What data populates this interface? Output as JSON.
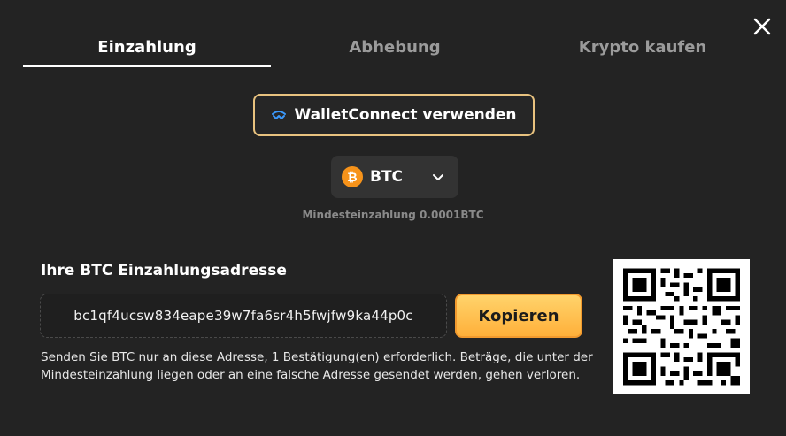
{
  "tabs": [
    {
      "label": "Einzahlung",
      "active": true
    },
    {
      "label": "Abhebung",
      "active": false
    },
    {
      "label": "Krypto kaufen",
      "active": false
    }
  ],
  "walletconnect": {
    "label": "WalletConnect verwenden",
    "icon": "walletconnect-icon"
  },
  "coin": {
    "name": "BTC",
    "icon_letter": "₿",
    "icon_color": "#f7931a"
  },
  "min_deposit": "Mindesteinzahlung 0.0001BTC",
  "address_section": {
    "title": "Ihre BTC Einzahlungsadresse",
    "address": "bc1qf4ucsw834eape39w7fa6sr4h5fwjfw9ka44p0c",
    "copy_label": "Kopieren"
  },
  "notice": "Senden Sie BTC nur an diese Adresse, 1 Bestätigung(en) erforderlich. Beträge, die unter der Mindesteinzahlung liegen oder an eine falsche Adresse gesendet werden, gehen verloren.",
  "colors": {
    "accent": "#ffb03a",
    "walletconnect_border": "#e8c27f",
    "background": "#232323"
  }
}
